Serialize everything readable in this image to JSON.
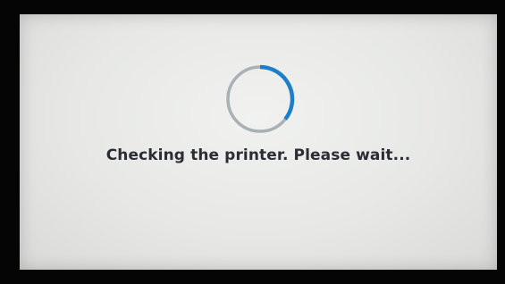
{
  "status": {
    "message": "Checking the printer. Please wait...",
    "spinner_icon": "loading-spinner-icon"
  },
  "colors": {
    "spinner_active": "#1c7fc8",
    "spinner_track": "#a9b0b6",
    "text": "#2a2d33",
    "screen_background": "#e9eae8"
  }
}
